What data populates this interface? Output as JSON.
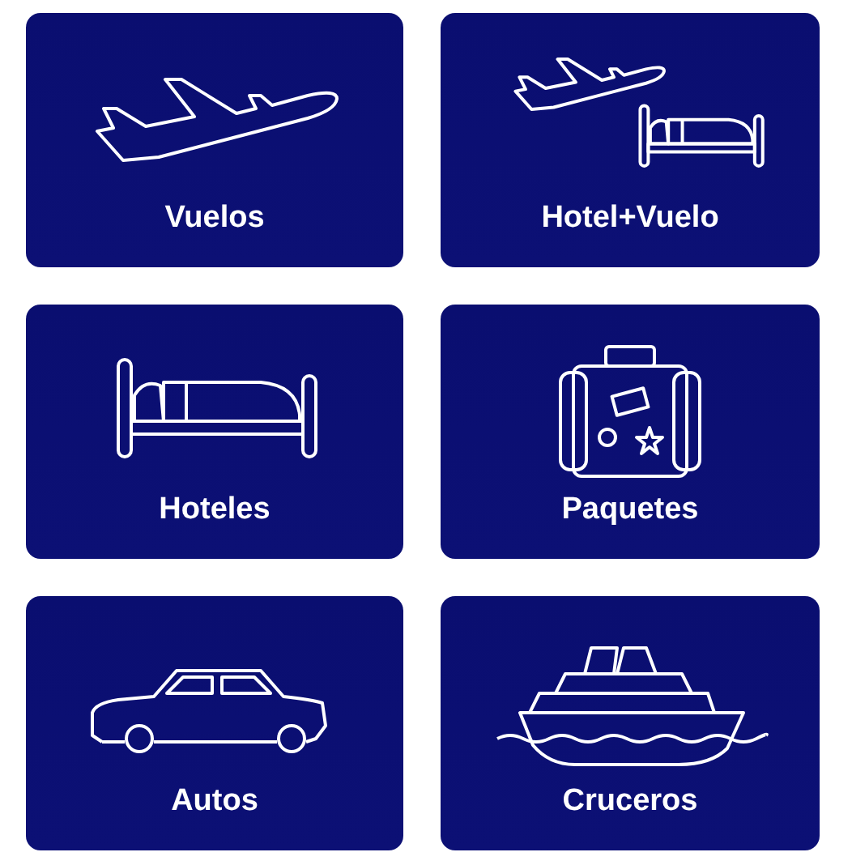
{
  "categories": [
    {
      "kind": "plane",
      "label": "Vuelos"
    },
    {
      "kind": "hotel-plane",
      "label": "Hotel+Vuelo"
    },
    {
      "kind": "bed",
      "label": "Hoteles"
    },
    {
      "kind": "suitcase",
      "label": "Paquetes"
    },
    {
      "kind": "car",
      "label": "Autos"
    },
    {
      "kind": "ship",
      "label": "Cruceros"
    }
  ]
}
